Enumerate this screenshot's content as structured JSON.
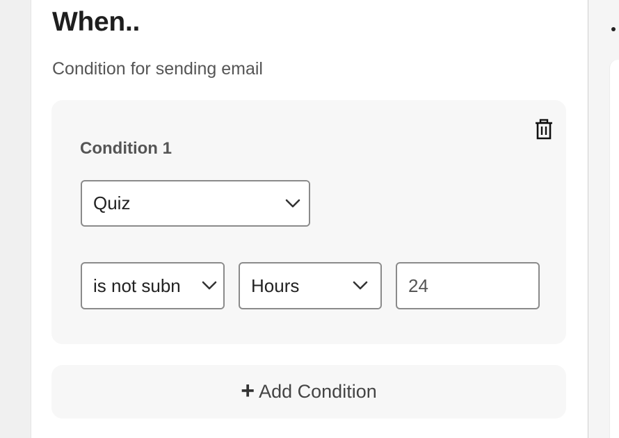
{
  "header": {
    "title": "When..",
    "subtitle": "Condition for sending email"
  },
  "condition": {
    "label": "Condition 1",
    "delete_icon": "trash-icon",
    "type_select": {
      "value": "Quiz",
      "icon": "chevron-down-icon"
    },
    "status_select": {
      "value": "is not subn",
      "icon": "chevron-down-icon"
    },
    "unit_select": {
      "value": "Hours",
      "icon": "chevron-down-icon"
    },
    "amount_input": {
      "value": "24"
    }
  },
  "add_condition": {
    "icon": "plus-icon",
    "label": "Add Condition"
  }
}
